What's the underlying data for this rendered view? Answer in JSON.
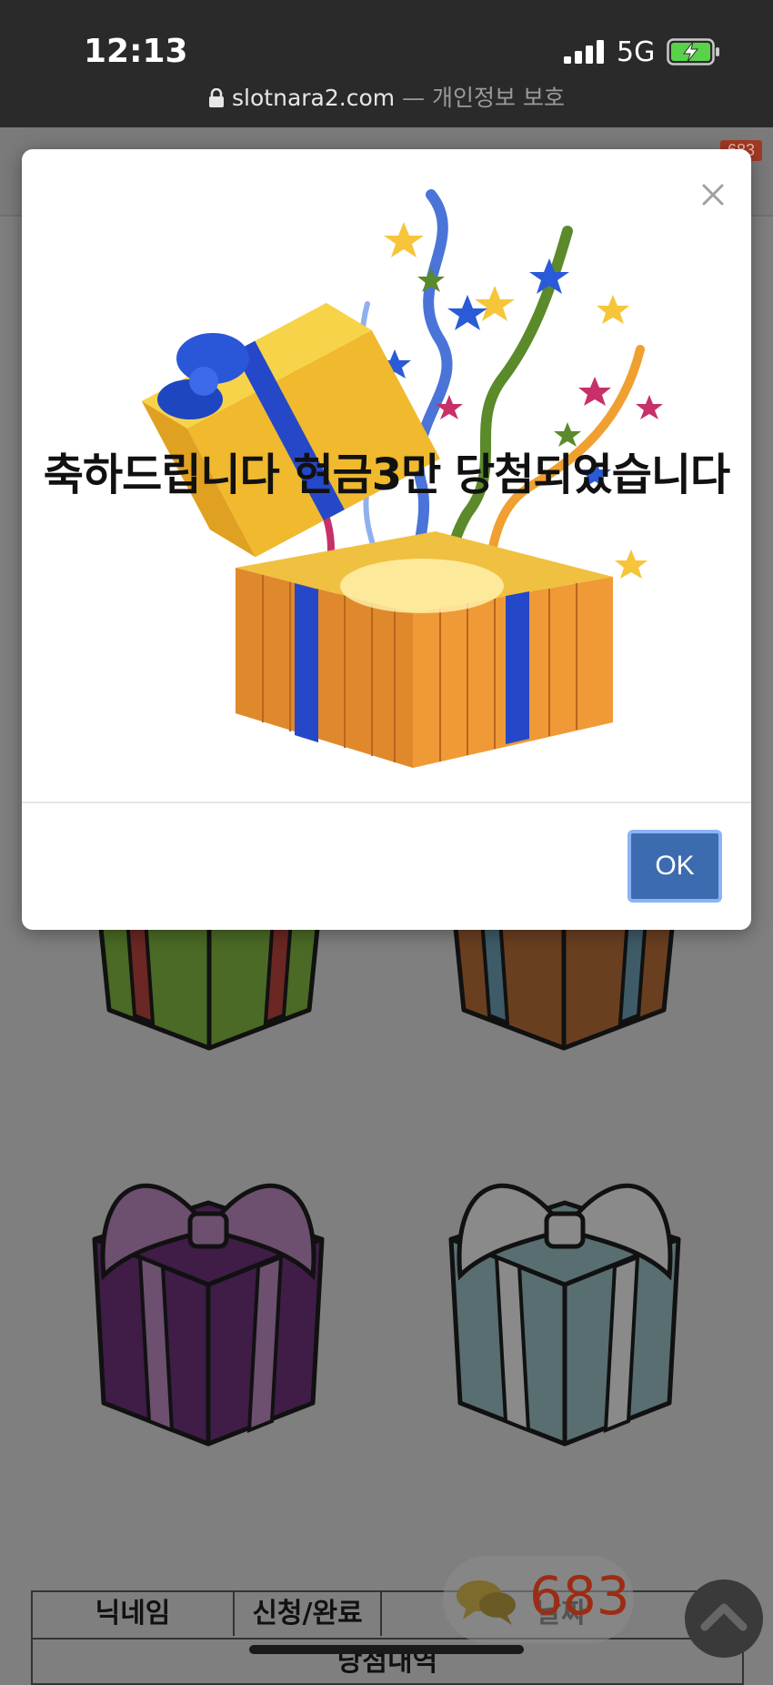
{
  "status_bar": {
    "time": "12:13",
    "network": "5G",
    "battery_icon": "battery-charging-icon",
    "signal_icon": "signal-icon"
  },
  "browser": {
    "url": "slotnara2.com",
    "separator": "—",
    "privacy_label": "개인정보 보호",
    "lock_icon": "lock-icon"
  },
  "background_page": {
    "badge": "683",
    "table": {
      "headers": [
        "닉네임",
        "신청/완료",
        "날짜"
      ],
      "section_label": "당첨내역"
    },
    "chat_widget": {
      "count": "683",
      "icon": "chat-bubbles-icon",
      "color": "#9a2d14"
    },
    "scroll_top_icon": "chevron-up-icon"
  },
  "modal": {
    "title": "축하드립니다 현금3만 당첨되었습니다",
    "close_icon": "close-icon",
    "image": "open-gift-box-with-confetti",
    "ok_label": "OK",
    "ok_color": "#3c6bb0"
  }
}
